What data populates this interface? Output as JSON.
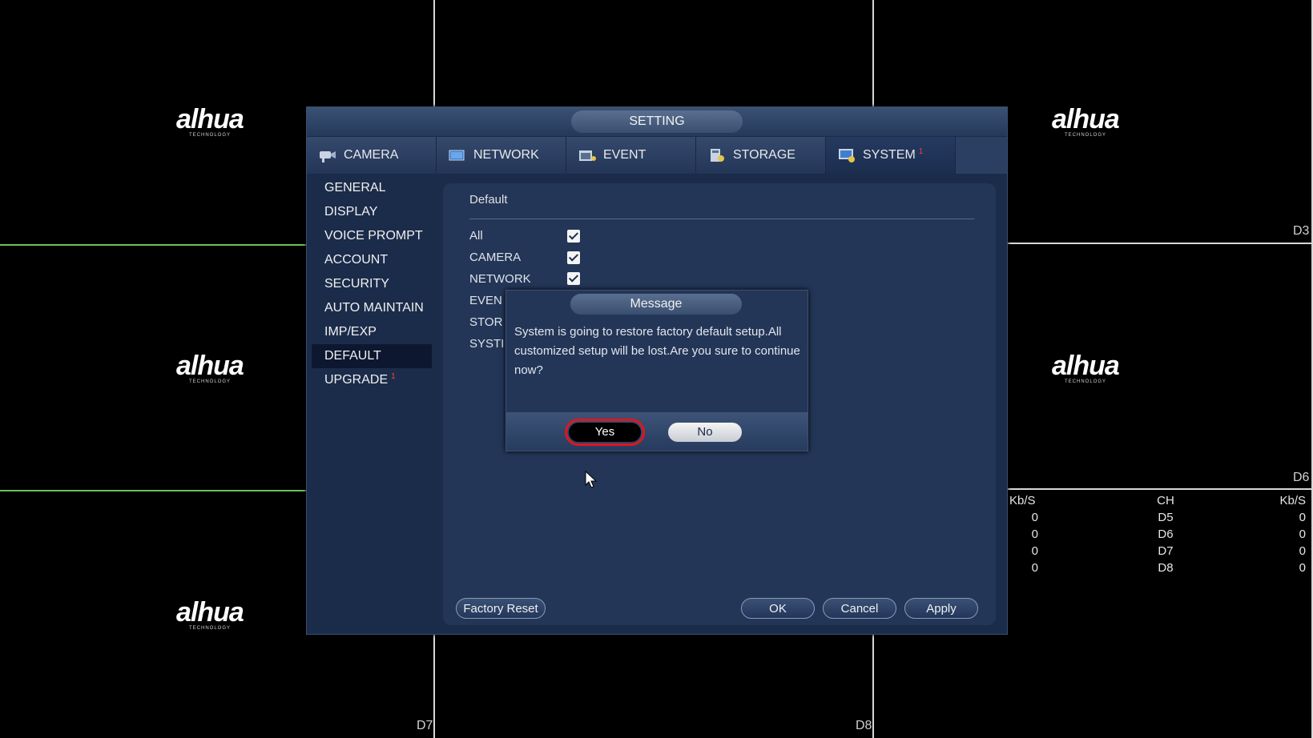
{
  "background": {
    "logo_text": "alhua",
    "logo_subtext": "TECHNOLOGY",
    "channel_labels": {
      "d3": "D3",
      "d6": "D6",
      "d7": "D7",
      "d8": "D8"
    },
    "stats": {
      "headers": [
        "Kb/S",
        "CH",
        "Kb/S"
      ],
      "rows": [
        [
          "0",
          "D5",
          "0"
        ],
        [
          "0",
          "D6",
          "0"
        ],
        [
          "0",
          "D7",
          "0"
        ],
        [
          "0",
          "D8",
          "0"
        ]
      ]
    }
  },
  "setting": {
    "title": "SETTING",
    "tabs": [
      {
        "label": "CAMERA",
        "icon": "camera-icon"
      },
      {
        "label": "NETWORK",
        "icon": "network-icon"
      },
      {
        "label": "EVENT",
        "icon": "event-icon"
      },
      {
        "label": "STORAGE",
        "icon": "storage-icon"
      },
      {
        "label": "SYSTEM",
        "icon": "system-icon",
        "badge": "1",
        "active": true
      }
    ],
    "sidebar": [
      {
        "label": "GENERAL"
      },
      {
        "label": "DISPLAY"
      },
      {
        "label": "VOICE PROMPT"
      },
      {
        "label": "ACCOUNT"
      },
      {
        "label": "SECURITY"
      },
      {
        "label": "AUTO MAINTAIN"
      },
      {
        "label": "IMP/EXP"
      },
      {
        "label": "DEFAULT",
        "active": true
      },
      {
        "label": "UPGRADE",
        "badge": "1"
      }
    ],
    "panel": {
      "section_title": "Default",
      "options": [
        {
          "label": "All",
          "checked": true
        },
        {
          "label": "CAMERA",
          "checked": true
        },
        {
          "label": "NETWORK",
          "checked": true
        },
        {
          "label": "EVEN",
          "checked": true
        },
        {
          "label": "STOR",
          "checked": true
        },
        {
          "label": "SYSTI",
          "checked": true
        }
      ],
      "factory_reset_label": "Factory Reset",
      "ok_label": "OK",
      "cancel_label": "Cancel",
      "apply_label": "Apply"
    }
  },
  "message": {
    "title": "Message",
    "text": "System is going to restore factory default setup.All customized setup will be lost.Are you sure to continue now?",
    "yes_label": "Yes",
    "no_label": "No"
  },
  "colors": {
    "dialog_bg": "#1b2c4a",
    "panel_bg": "#233657",
    "highlight_red": "#e0161d",
    "badge_red": "#ff3b3b"
  }
}
